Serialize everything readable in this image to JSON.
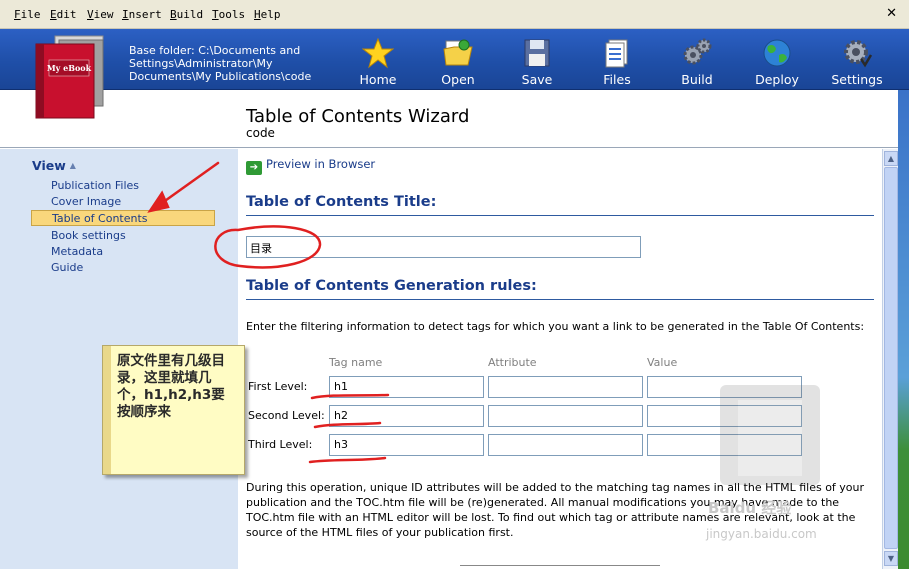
{
  "menu": [
    "File",
    "Edit",
    "View",
    "Insert",
    "Build",
    "Tools",
    "Help"
  ],
  "base_folder": "Base folder: C:\\Documents and Settings\\Administrator\\My Documents\\My Publications\\code",
  "logo_text": "My eBook",
  "toolbar": [
    {
      "label": "Home",
      "icon": "star-icon"
    },
    {
      "label": "Open",
      "icon": "open-folder-icon"
    },
    {
      "label": "Save",
      "icon": "floppy-disk-icon"
    },
    {
      "label": "Files",
      "icon": "files-icon"
    },
    {
      "label": "Build",
      "icon": "gears-icon"
    },
    {
      "label": "Deploy",
      "icon": "globe-icon"
    },
    {
      "label": "Settings",
      "icon": "settings-gear-icon"
    }
  ],
  "header": {
    "title": "Table of Contents Wizard",
    "subtitle": "code"
  },
  "nav": {
    "header": "View",
    "items": [
      "Publication Files",
      "Cover Image",
      "Table of Contents",
      "Book settings",
      "Metadata",
      "Guide"
    ],
    "selected": "Table of Contents"
  },
  "main": {
    "preview_link": "Preview in Browser",
    "toc_title_heading": "Table of Contents Title:",
    "toc_title_value": "目录",
    "rules_heading": "Table of Contents Generation rules:",
    "help_text": "Enter the filtering information to detect tags for which you want a link to be generated in the Table Of Contents:",
    "columns": [
      "Tag name",
      "Attribute",
      "Value"
    ],
    "rows": [
      {
        "label": "First Level:",
        "tag": "h1",
        "attribute": "",
        "value": ""
      },
      {
        "label": "Second Level:",
        "tag": "h2",
        "attribute": "",
        "value": ""
      },
      {
        "label": "Third Level:",
        "tag": "h3",
        "attribute": "",
        "value": ""
      }
    ],
    "description": "During this operation, unique ID attributes will be added to the matching tag names in all the HTML files of your publication and the TOC.htm file will be (re)generated. All manual modifications you may have made to the TOC.htm file with an HTML editor will be lost. To find out which tag or attribute names are relevant, look at the source of the HTML files of your publication first."
  },
  "annotation": {
    "callout_text": "原文件里有几级目录，这里就填几个，h1,h2,h3要按顺序来",
    "color": "#e02020"
  },
  "watermark": {
    "line1": "Baidu 经验",
    "line2": "jingyan.baidu.com"
  },
  "colors": {
    "toolbar": "#1f4fa8",
    "nav_bg": "#d8e4f4",
    "selected": "#f9d77c",
    "heading": "#1a3c8a"
  }
}
